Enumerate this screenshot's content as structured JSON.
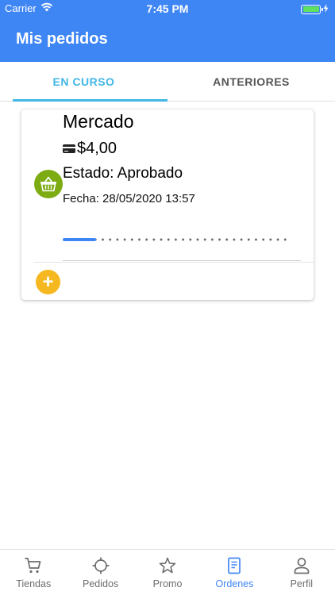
{
  "status_bar": {
    "carrier": "Carrier",
    "time": "7:45 PM",
    "wifi_icon": "wifi-icon",
    "battery_icon": "battery-charging-icon"
  },
  "app_bar": {
    "title": "Mis pedidos"
  },
  "tabs": [
    {
      "label": "EN CURSO",
      "active": true
    },
    {
      "label": "ANTERIORES",
      "active": false
    }
  ],
  "order": {
    "store": "Mercado",
    "payment_icon": "credit-card-icon",
    "price": "$4,00",
    "status": "Estado: Aprobado",
    "date": "Fecha: 28/05/2020 13:57",
    "avatar_icon": "basket-icon",
    "progress": 0.15,
    "add_icon": "plus-icon"
  },
  "bottom_nav": [
    {
      "label": "Tiendas",
      "icon": "cart-icon",
      "active": false
    },
    {
      "label": "Pedidos",
      "icon": "crosshair-icon",
      "active": false
    },
    {
      "label": "Promo",
      "icon": "star-icon",
      "active": false
    },
    {
      "label": "Ordenes",
      "icon": "receipt-icon",
      "active": true
    },
    {
      "label": "Perfil",
      "icon": "person-icon",
      "active": false
    }
  ],
  "colors": {
    "primary": "#3f86f5",
    "tab_accent": "#42b7e6",
    "avatar_green": "#7cab12",
    "add_yellow": "#f5b820",
    "inactive": "#6d6d6d"
  }
}
